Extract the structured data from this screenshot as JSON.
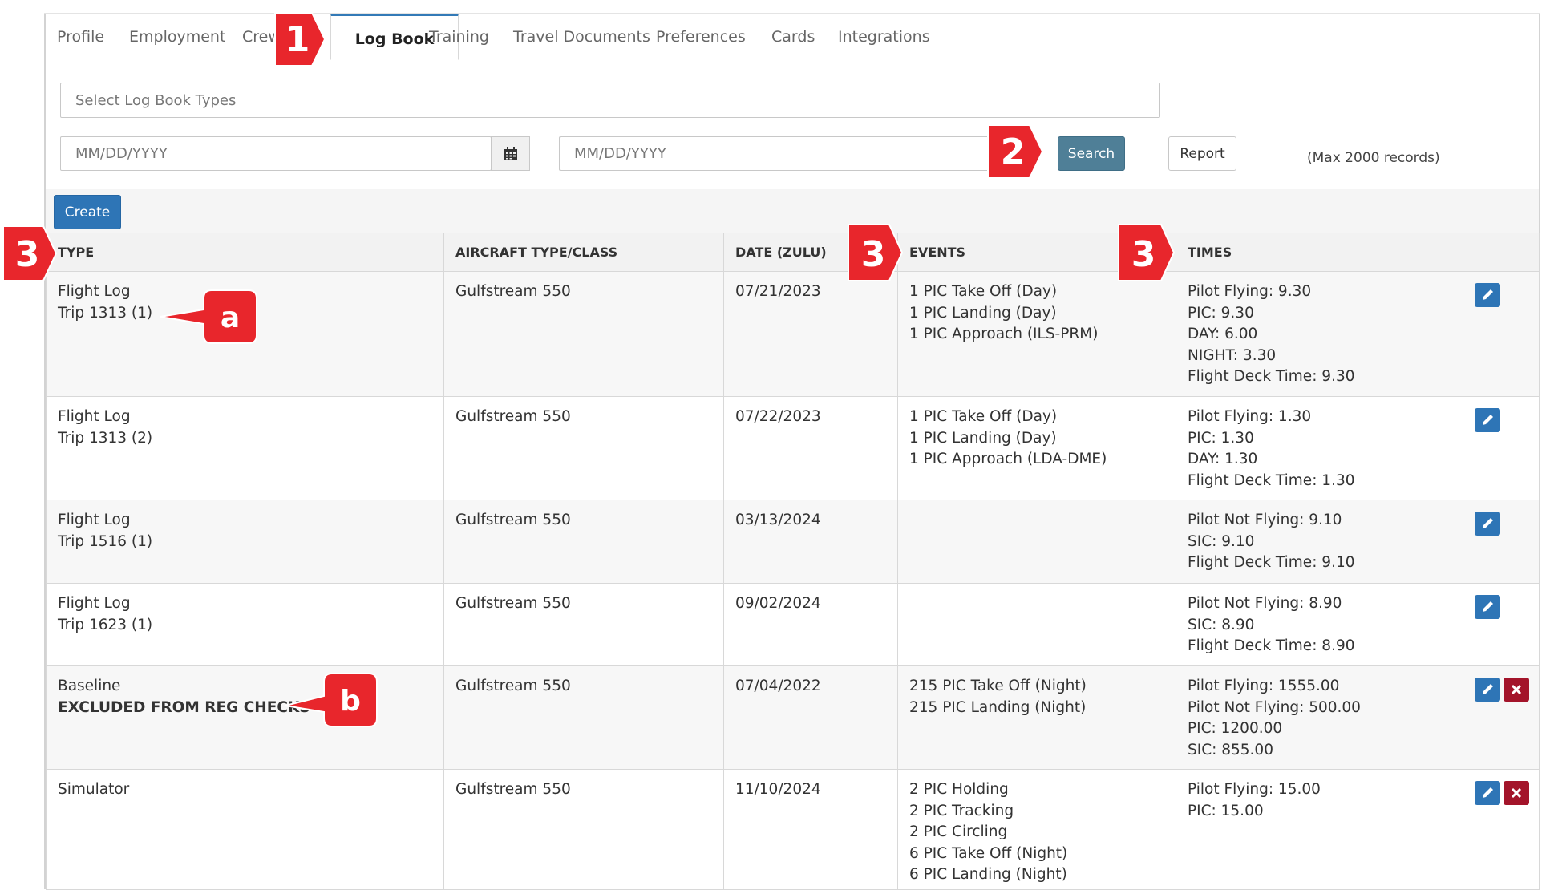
{
  "tabs": [
    {
      "label": "Profile"
    },
    {
      "label": "Employment"
    },
    {
      "label": "Crew"
    },
    {
      "label": "Log Book",
      "active": true
    },
    {
      "label": "Training"
    },
    {
      "label": "Travel Documents"
    },
    {
      "label": "Preferences"
    },
    {
      "label": "Cards"
    },
    {
      "label": "Integrations"
    }
  ],
  "filters": {
    "log_types_placeholder": "Select Log Book Types",
    "date_from_placeholder": "MM/DD/YYYY",
    "date_to_placeholder": "MM/DD/YYYY",
    "search_label": "Search",
    "report_label": "Report",
    "max_records": "(Max 2000 records)"
  },
  "create_label": "Create",
  "columns": [
    "TYPE",
    "AIRCRAFT TYPE/CLASS",
    "DATE (ZULU)",
    "EVENTS",
    "TIMES"
  ],
  "rows": [
    {
      "type": "Flight Log",
      "subtype": "Trip 1313 (1)",
      "aircraft": "Gulfstream 550",
      "date": "07/21/2023",
      "events": [
        "1 PIC Take Off (Day)",
        "1 PIC Landing (Day)",
        "1 PIC Approach (ILS-PRM)"
      ],
      "times": [
        "Pilot Flying: 9.30",
        "PIC: 9.30",
        "DAY: 6.00",
        "NIGHT: 3.30",
        "Flight Deck Time: 9.30"
      ],
      "deletable": false
    },
    {
      "type": "Flight Log",
      "subtype": "Trip 1313 (2)",
      "aircraft": "Gulfstream 550",
      "date": "07/22/2023",
      "events": [
        "1 PIC Take Off (Day)",
        "1 PIC Landing (Day)",
        "1 PIC Approach (LDA-DME)"
      ],
      "times": [
        "Pilot Flying: 1.30",
        "PIC: 1.30",
        "DAY: 1.30",
        "Flight Deck Time: 1.30"
      ],
      "deletable": false
    },
    {
      "type": "Flight Log",
      "subtype": "Trip 1516 (1)",
      "aircraft": "Gulfstream 550",
      "date": "03/13/2024",
      "events": [],
      "times": [
        "Pilot Not Flying: 9.10",
        "SIC: 9.10",
        "Flight Deck Time: 9.10"
      ],
      "deletable": false
    },
    {
      "type": "Flight Log",
      "subtype": "Trip 1623 (1)",
      "aircraft": "Gulfstream 550",
      "date": "09/02/2024",
      "events": [],
      "times": [
        "Pilot Not Flying: 8.90",
        "SIC: 8.90",
        "Flight Deck Time: 8.90"
      ],
      "deletable": false
    },
    {
      "type": "Baseline",
      "subtype": "EXCLUDED FROM REG CHECKS",
      "subtype_bold": true,
      "aircraft": "Gulfstream 550",
      "date": "07/04/2022",
      "events": [
        "215 PIC Take Off (Night)",
        "215 PIC Landing (Night)"
      ],
      "times": [
        "Pilot Flying: 1555.00",
        "Pilot Not Flying: 500.00",
        "PIC: 1200.00",
        "SIC: 855.00"
      ],
      "deletable": true
    },
    {
      "type": "Simulator",
      "subtype": "",
      "aircraft": "Gulfstream 550",
      "date": "11/10/2024",
      "events": [
        "2 PIC Holding",
        "2 PIC Tracking",
        "2 PIC Circling",
        "6 PIC Take Off (Night)",
        "6 PIC Landing (Night)"
      ],
      "times": [
        "Pilot Flying: 15.00",
        "PIC: 15.00"
      ],
      "deletable": true
    }
  ],
  "callouts": [
    "1",
    "2",
    "3",
    "3",
    "3",
    "a",
    "b"
  ],
  "colors": {
    "callout": "#e8262c",
    "edit": "#2e75b6",
    "delete": "#a3142a",
    "search": "#4f7f97",
    "active_tab": "#337ab7"
  }
}
